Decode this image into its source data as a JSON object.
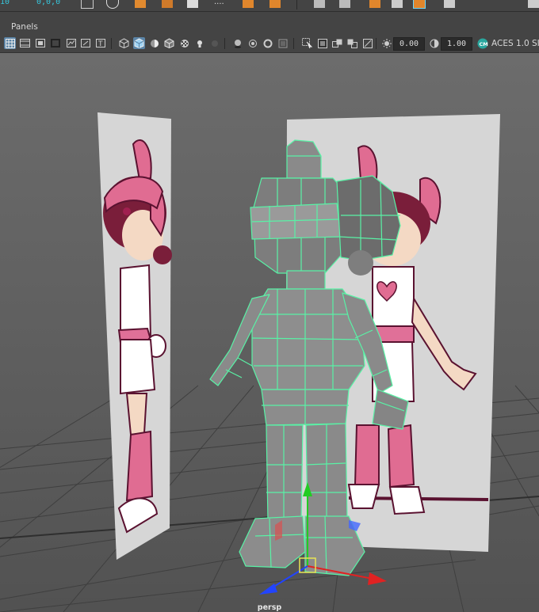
{
  "topbar": {
    "coord_left": "0,0,0",
    "coord_partial": "10"
  },
  "menubar": {
    "panels_label": "Panels"
  },
  "toolbar": {
    "value_a": "0.00",
    "value_b": "1.00",
    "colorspace": "ACES 1.0 SI"
  },
  "viewport": {
    "camera_label": "persp"
  },
  "colors": {
    "wireframe": "#59f2a6",
    "accent": "#37c6dc",
    "x_axis": "#e02222",
    "y_axis": "#22cc22",
    "z_axis": "#2244ff"
  }
}
